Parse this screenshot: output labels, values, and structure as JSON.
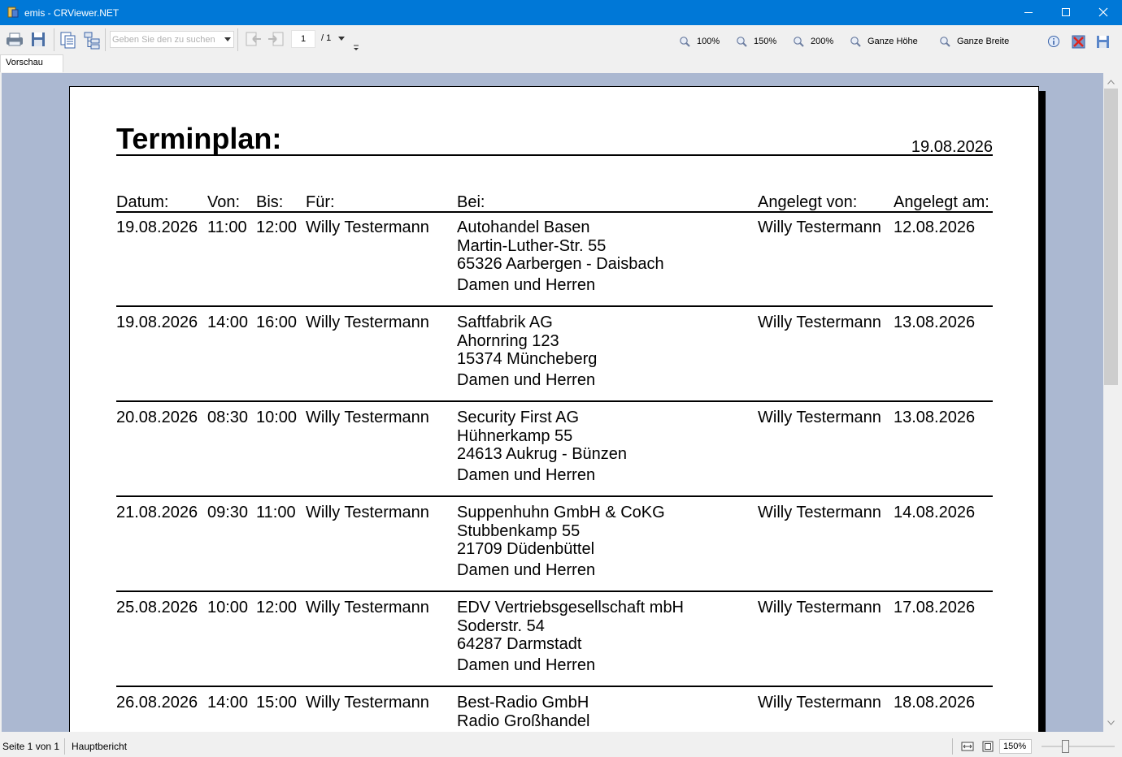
{
  "window": {
    "title": "emis - CRViewer.NET",
    "colors": {
      "titlebar": "#0078d7",
      "background": "#abb8d1"
    }
  },
  "toolbar": {
    "search_placeholder": "Geben Sie den zu suchen",
    "page_number": "1",
    "page_total": "/ 1",
    "zoom_buttons": [
      "100%",
      "150%",
      "200%",
      "Ganze Höhe",
      "Ganze Breite"
    ]
  },
  "tab": {
    "label": "Vorschau"
  },
  "report": {
    "title": "Terminplan:",
    "date": "19.08.2026",
    "columns": [
      "Datum:",
      "Von:",
      "Bis:",
      "Für:",
      "Bei:",
      "Angelegt von:",
      "Angelegt am:"
    ],
    "rows": [
      {
        "datum": "19.08.2026",
        "von": "11:00",
        "bis": "12:00",
        "fuer": "Willy Testermann",
        "bei": [
          "Autohandel Basen",
          "Martin-Luther-Str. 55",
          "65326 Aarbergen - Daisbach",
          "Damen und Herren"
        ],
        "angelegt_von": "Willy Testermann",
        "angelegt_am": "12.08.2026"
      },
      {
        "datum": "19.08.2026",
        "von": "14:00",
        "bis": "16:00",
        "fuer": "Willy Testermann",
        "bei": [
          "Saftfabrik AG",
          "Ahornring 123",
          "15374 Müncheberg",
          "Damen und Herren"
        ],
        "angelegt_von": "Willy Testermann",
        "angelegt_am": "13.08.2026"
      },
      {
        "datum": "20.08.2026",
        "von": "08:30",
        "bis": "10:00",
        "fuer": "Willy Testermann",
        "bei": [
          "Security First AG",
          "Hühnerkamp 55",
          "24613 Aukrug - Bünzen",
          "Damen und Herren"
        ],
        "angelegt_von": "Willy Testermann",
        "angelegt_am": "13.08.2026"
      },
      {
        "datum": "21.08.2026",
        "von": "09:30",
        "bis": "11:00",
        "fuer": "Willy Testermann",
        "bei": [
          "Suppenhuhn GmbH & CoKG",
          "Stubbenkamp 55",
          "21709 Düdenbüttel",
          "Damen und Herren"
        ],
        "angelegt_von": "Willy Testermann",
        "angelegt_am": "14.08.2026"
      },
      {
        "datum": "25.08.2026",
        "von": "10:00",
        "bis": "12:00",
        "fuer": "Willy Testermann",
        "bei": [
          "EDV Vertriebsgesellschaft mbH",
          "Soderstr. 54",
          "64287 Darmstadt",
          "Damen und Herren"
        ],
        "angelegt_von": "Willy Testermann",
        "angelegt_am": "17.08.2026"
      },
      {
        "datum": "26.08.2026",
        "von": "14:00",
        "bis": "15:00",
        "fuer": "Willy Testermann",
        "bei": [
          "Best-Radio GmbH",
          "Radio Großhandel"
        ],
        "angelegt_von": "Willy Testermann",
        "angelegt_am": "18.08.2026"
      }
    ]
  },
  "statusbar": {
    "page_info": "Seite 1 von 1",
    "report_name": "Hauptbericht",
    "zoom": "150%"
  }
}
